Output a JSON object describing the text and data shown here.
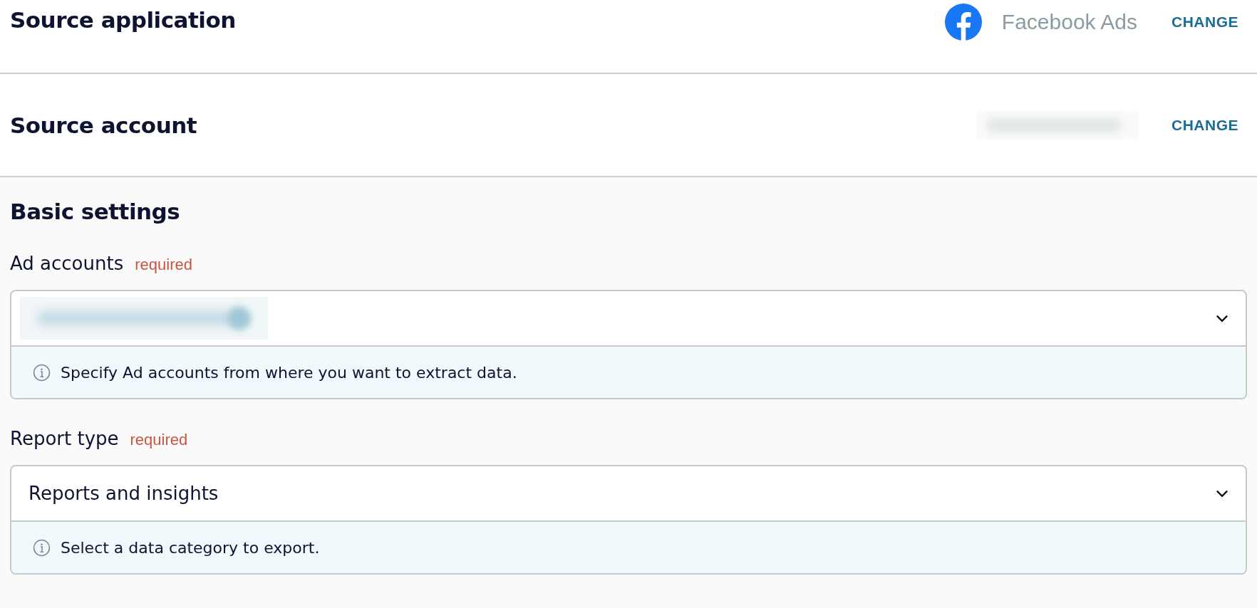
{
  "source_application": {
    "title": "Source application",
    "app_name": "Facebook Ads",
    "action": "CHANGE"
  },
  "source_account": {
    "title": "Source account",
    "value": {
      "kind": "redacted"
    },
    "action": "CHANGE"
  },
  "basic_settings": {
    "title": "Basic settings",
    "fields": [
      {
        "label": "Ad accounts",
        "badge": "required",
        "value": {
          "kind": "redacted"
        },
        "hint": "Specify Ad accounts from where you want to extract data."
      },
      {
        "label": "Report type",
        "badge": "required",
        "value": {
          "kind": "text",
          "text": "Reports and insights"
        },
        "hint": "Select a data category to export."
      }
    ]
  }
}
